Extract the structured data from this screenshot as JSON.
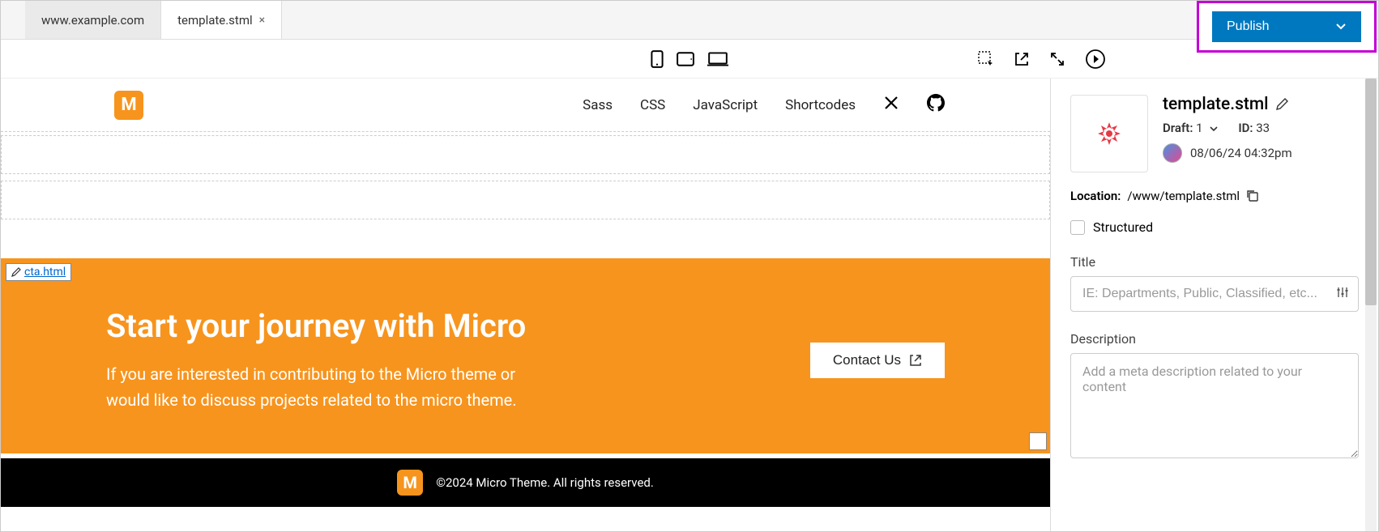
{
  "tabs": [
    {
      "label": "www.example.com",
      "active": false,
      "closable": false
    },
    {
      "label": "template.stml",
      "active": true,
      "closable": true
    }
  ],
  "publish_label": "Publish",
  "site": {
    "nav": [
      "Sass",
      "CSS",
      "JavaScript",
      "Shortcodes"
    ],
    "cta_tag": "cta.html",
    "cta_heading": "Start your journey with Micro",
    "cta_body": "If you are interested in contributing to the Micro theme or would like to discuss projects related to the micro theme.",
    "contact_label": "Contact Us",
    "footer": "©2024 Micro Theme. All rights reserved."
  },
  "panel": {
    "filename": "template.stml",
    "draft_label": "Draft:",
    "draft_value": "1",
    "id_label": "ID:",
    "id_value": "33",
    "timestamp": "08/06/24 04:32pm",
    "location_label": "Location:",
    "location_value": "/www/template.stml",
    "structured_label": "Structured",
    "title_label": "Title",
    "title_placeholder": "IE: Departments, Public, Classified, etc...",
    "description_label": "Description",
    "description_placeholder": "Add a meta description related to your content"
  }
}
